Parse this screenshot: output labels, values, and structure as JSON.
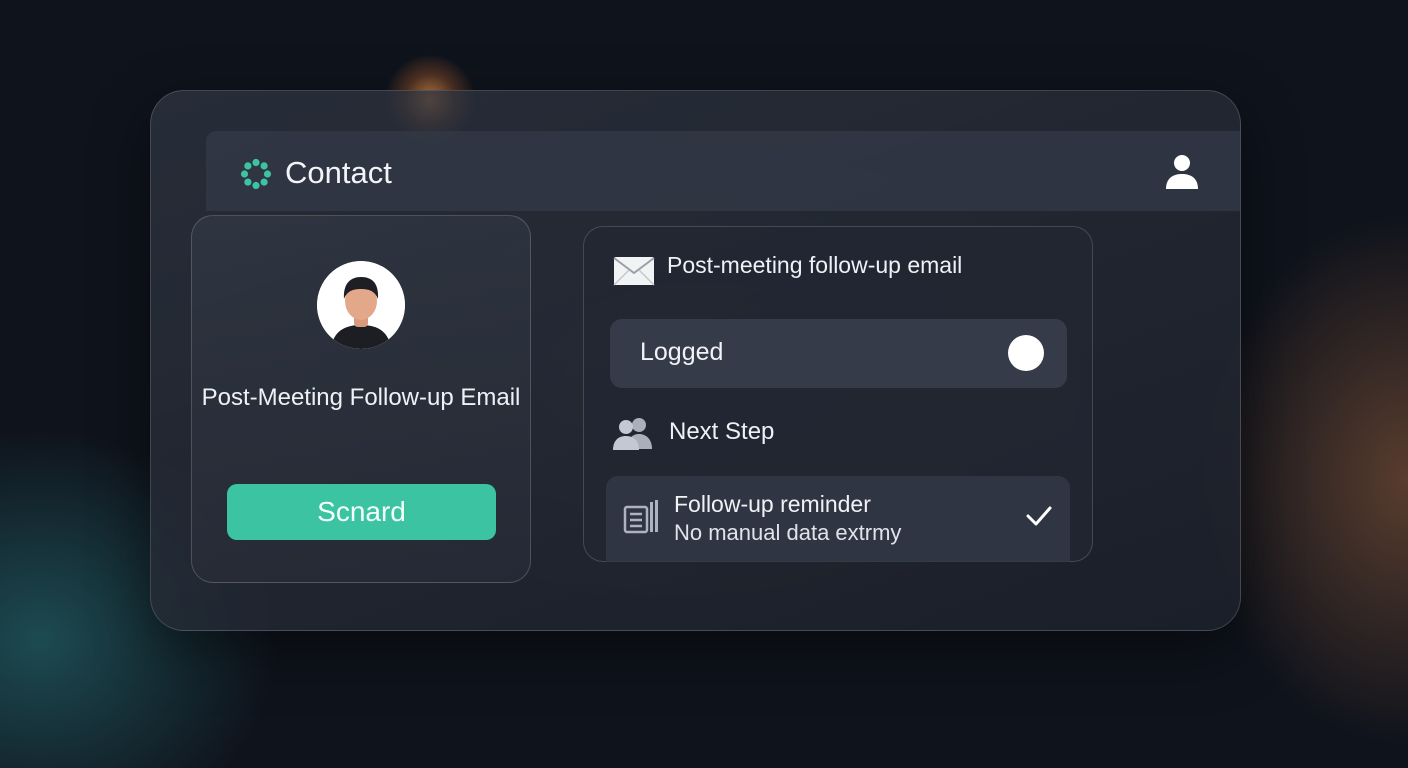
{
  "header": {
    "title": "Contact",
    "icons": {
      "brand": "loading-dots-icon",
      "user": "user-icon"
    }
  },
  "contact_card": {
    "avatar": "person-avatar",
    "title": "Post-Meeting Follow-up Email",
    "button_label": "Scnard"
  },
  "activity_panel": {
    "email": {
      "icon": "envelope-icon",
      "label": "Post-meeting follow-up email"
    },
    "status": {
      "label": "Logged",
      "toggle_on": true
    },
    "next_step": {
      "icon": "people-icon",
      "label": "Next Step"
    },
    "reminder": {
      "icon": "document-icon",
      "title": "Follow-up reminder",
      "subtitle": "No manual data extrmy",
      "check_icon": "checkmark-icon"
    }
  },
  "colors": {
    "accent": "#3cc3a2",
    "background": "#0f131c",
    "panel": "#222732"
  }
}
